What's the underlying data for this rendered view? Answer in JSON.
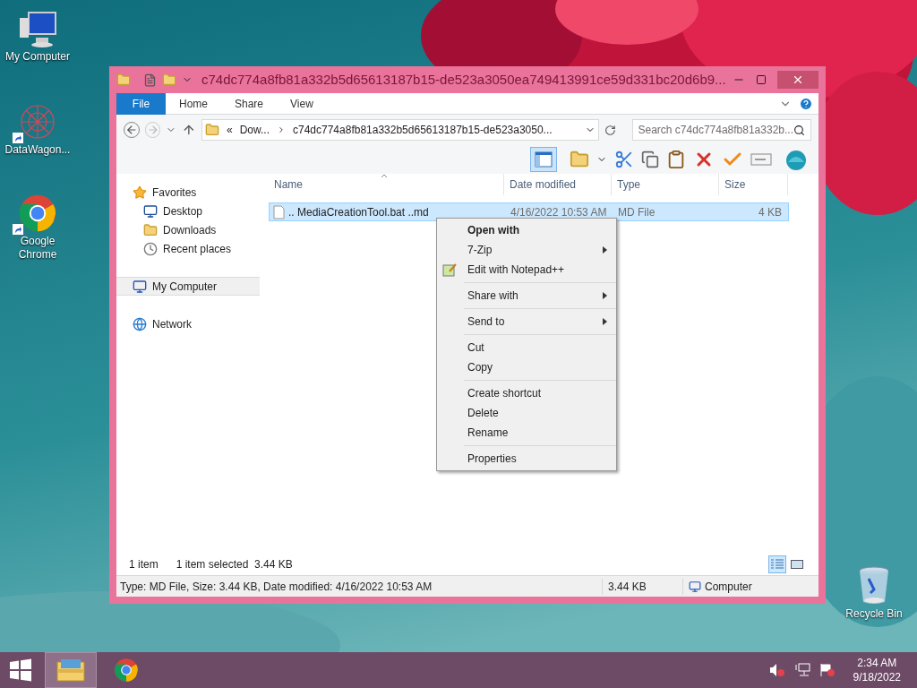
{
  "desktop_icons": [
    {
      "label": "My Computer",
      "kind": "computer",
      "shortcut": false
    },
    {
      "label": "DataWagon...",
      "kind": "datawagon",
      "shortcut": true
    },
    {
      "label": "Google Chrome",
      "kind": "chrome",
      "shortcut": true
    },
    {
      "label": "Recycle Bin",
      "kind": "recycle",
      "shortcut": false
    }
  ],
  "window": {
    "title": "c74dc774a8fb81a332b5d65613187b15-de523a3050ea749413991ce59d331bc20d6b9...",
    "ribbon_tabs": [
      {
        "label": "File",
        "selected": true
      },
      {
        "label": "Home",
        "selected": false
      },
      {
        "label": "Share",
        "selected": false
      },
      {
        "label": "View",
        "selected": false
      }
    ],
    "address": {
      "overflow": "«",
      "crumbs": [
        "Dow...",
        "c74dc774a8fb81a332b5d65613187b15-de523a3050..."
      ]
    },
    "search": {
      "placeholder": "Search c74dc774a8fb81a332b..."
    },
    "nav": [
      {
        "label": "Favorites",
        "kind": "star",
        "selected": false,
        "children": [
          {
            "label": "Desktop",
            "kind": "desktop",
            "selected": false
          },
          {
            "label": "Downloads",
            "kind": "downloads",
            "selected": false
          },
          {
            "label": "Recent places",
            "kind": "recent",
            "selected": false
          }
        ]
      },
      {
        "label": "My Computer",
        "kind": "computer",
        "selected": true
      },
      {
        "label": "Network",
        "kind": "network",
        "selected": false
      }
    ],
    "columns": [
      "Name",
      "Date modified",
      "Type",
      "Size"
    ],
    "rows": [
      {
        "name": ".. MediaCreationTool.bat ..md",
        "date": "4/16/2022 10:53 AM",
        "type": "MD File",
        "size": "4 KB",
        "selected": true
      }
    ],
    "status": {
      "count": "1 item",
      "selection": "1 item selected  3.44 KB"
    },
    "view_buttons": [
      {
        "kind": "details",
        "selected": true
      },
      {
        "kind": "large",
        "selected": false
      }
    ],
    "details_bar": {
      "info": "Type: MD File, Size: 3.44 KB, Date modified: 4/16/2022 10:53 AM",
      "size": "3.44 KB",
      "location": "Computer"
    }
  },
  "context_menu": {
    "groups": [
      [
        {
          "label": "Open with",
          "kind": "default",
          "submenu": false
        },
        {
          "label": "7-Zip",
          "kind": "plain",
          "submenu": true
        },
        {
          "label": "Edit with Notepad++",
          "kind": "notepad",
          "submenu": false
        }
      ],
      [
        {
          "label": "Share with",
          "kind": "plain",
          "submenu": true
        }
      ],
      [
        {
          "label": "Send to",
          "kind": "plain",
          "submenu": true
        }
      ],
      [
        {
          "label": "Cut",
          "kind": "plain",
          "submenu": false
        },
        {
          "label": "Copy",
          "kind": "plain",
          "submenu": false
        }
      ],
      [
        {
          "label": "Create shortcut",
          "kind": "plain",
          "submenu": false
        },
        {
          "label": "Delete",
          "kind": "plain",
          "submenu": false
        },
        {
          "label": "Rename",
          "kind": "plain",
          "submenu": false
        }
      ],
      [
        {
          "label": "Properties",
          "kind": "plain",
          "submenu": false
        }
      ]
    ]
  },
  "taskbar": {
    "apps": [
      {
        "kind": "explorer",
        "selected": true
      },
      {
        "kind": "chrome",
        "selected": false
      }
    ],
    "time": "2:34 AM",
    "date": "9/18/2022"
  }
}
